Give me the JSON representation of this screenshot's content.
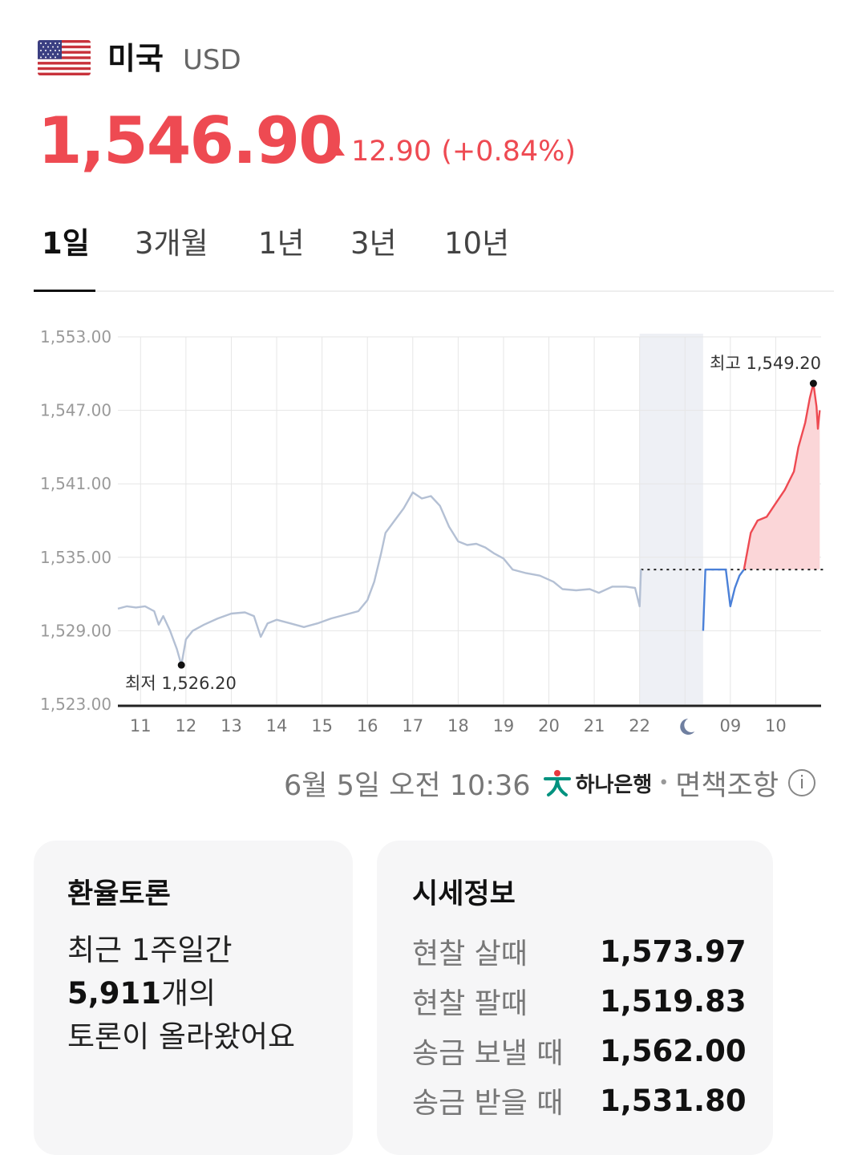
{
  "header": {
    "country": "미국",
    "code": "USD",
    "price": "1,546.90",
    "change": "12.90",
    "change_pct": "(+0.84%)",
    "change_direction": "up",
    "up_color": "#ee4a52"
  },
  "tabs": [
    {
      "label": "1일",
      "active": true
    },
    {
      "label": "3개월",
      "active": false
    },
    {
      "label": "1년",
      "active": false
    },
    {
      "label": "3년",
      "active": false
    },
    {
      "label": "10년",
      "active": false
    }
  ],
  "chart_data": {
    "type": "line",
    "y_ticks": [
      "1,553.00",
      "1,547.00",
      "1,541.00",
      "1,535.00",
      "1,529.00",
      "1,523.00"
    ],
    "ylim": [
      1523,
      1553
    ],
    "x_ticks": [
      "11",
      "12",
      "13",
      "14",
      "15",
      "16",
      "17",
      "18",
      "19",
      "20",
      "21",
      "22",
      "moon-icon",
      "09",
      "10"
    ],
    "reference_value": 1534.0,
    "high_label": "최고 1,549.20",
    "low_label": "최저 1,526.20",
    "high": 1549.2,
    "low": 1526.2,
    "series": [
      {
        "segment": "previous-day",
        "color": "#b4c0d4",
        "points": [
          [
            10.5,
            1530.8
          ],
          [
            10.7,
            1531.0
          ],
          [
            10.9,
            1530.9
          ],
          [
            11.1,
            1531.0
          ],
          [
            11.3,
            1530.6
          ],
          [
            11.4,
            1529.5
          ],
          [
            11.5,
            1530.2
          ],
          [
            11.65,
            1529.0
          ],
          [
            11.8,
            1527.5
          ],
          [
            11.9,
            1526.2
          ],
          [
            12.0,
            1528.3
          ],
          [
            12.15,
            1529.0
          ],
          [
            12.4,
            1529.5
          ],
          [
            12.7,
            1530.0
          ],
          [
            13.0,
            1530.4
          ],
          [
            13.3,
            1530.5
          ],
          [
            13.5,
            1530.2
          ],
          [
            13.65,
            1528.5
          ],
          [
            13.8,
            1529.6
          ],
          [
            14.0,
            1529.9
          ],
          [
            14.3,
            1529.6
          ],
          [
            14.6,
            1529.3
          ],
          [
            14.9,
            1529.6
          ],
          [
            15.2,
            1530.0
          ],
          [
            15.5,
            1530.3
          ],
          [
            15.8,
            1530.6
          ],
          [
            16.0,
            1531.5
          ],
          [
            16.15,
            1533.0
          ],
          [
            16.3,
            1535.3
          ],
          [
            16.4,
            1537.0
          ],
          [
            16.6,
            1538.0
          ],
          [
            16.8,
            1539.0
          ],
          [
            17.0,
            1540.3
          ],
          [
            17.2,
            1539.8
          ],
          [
            17.4,
            1540.0
          ],
          [
            17.6,
            1539.2
          ],
          [
            17.8,
            1537.5
          ],
          [
            18.0,
            1536.3
          ],
          [
            18.2,
            1536.0
          ],
          [
            18.4,
            1536.1
          ],
          [
            18.6,
            1535.8
          ],
          [
            18.8,
            1535.3
          ],
          [
            19.0,
            1534.9
          ],
          [
            19.2,
            1534.0
          ],
          [
            19.5,
            1533.7
          ],
          [
            19.8,
            1533.5
          ],
          [
            20.1,
            1533.0
          ],
          [
            20.3,
            1532.4
          ],
          [
            20.6,
            1532.3
          ],
          [
            20.9,
            1532.4
          ],
          [
            21.1,
            1532.1
          ],
          [
            21.4,
            1532.6
          ],
          [
            21.7,
            1532.6
          ],
          [
            21.9,
            1532.5
          ],
          [
            22.0,
            1531.0
          ],
          [
            22.03,
            1534.0
          ]
        ]
      },
      {
        "segment": "today-down",
        "color": "#4a80d8",
        "points": [
          [
            23.4,
            1529.0
          ],
          [
            23.45,
            1534.0
          ],
          [
            23.9,
            1534.0
          ],
          [
            24.0,
            1531.0
          ],
          [
            24.1,
            1532.5
          ],
          [
            24.2,
            1533.5
          ],
          [
            24.3,
            1534.0
          ]
        ]
      },
      {
        "segment": "today-up",
        "color": "#ee4a52",
        "points": [
          [
            24.3,
            1534.0
          ],
          [
            24.45,
            1537.0
          ],
          [
            24.6,
            1538.0
          ],
          [
            24.8,
            1538.3
          ],
          [
            25.0,
            1539.4
          ],
          [
            25.2,
            1540.5
          ],
          [
            25.4,
            1542.0
          ],
          [
            25.5,
            1544.0
          ],
          [
            25.65,
            1546.0
          ],
          [
            25.75,
            1548.0
          ],
          [
            25.83,
            1549.2
          ],
          [
            25.9,
            1547.3
          ],
          [
            25.93,
            1545.5
          ],
          [
            25.97,
            1547.0
          ]
        ]
      }
    ],
    "night_band": [
      22.0,
      23.4
    ]
  },
  "footer": {
    "timestamp": "6월 5일 오전 10:36",
    "bank": "하나은행",
    "disclaimer": "면책조항"
  },
  "discussion": {
    "title": "환율토론",
    "line1": "최근 1주일간",
    "count": "5,911",
    "count_suffix": "개의",
    "line3": "토론이 올라왔어요"
  },
  "rates": {
    "title": "시세정보",
    "rows": [
      {
        "label": "현찰 살때",
        "value": "1,573.97"
      },
      {
        "label": "현찰 팔때",
        "value": "1,519.83"
      },
      {
        "label": "송금 보낼 때",
        "value": "1,562.00"
      },
      {
        "label": "송금 받을 때",
        "value": "1,531.80"
      }
    ]
  }
}
